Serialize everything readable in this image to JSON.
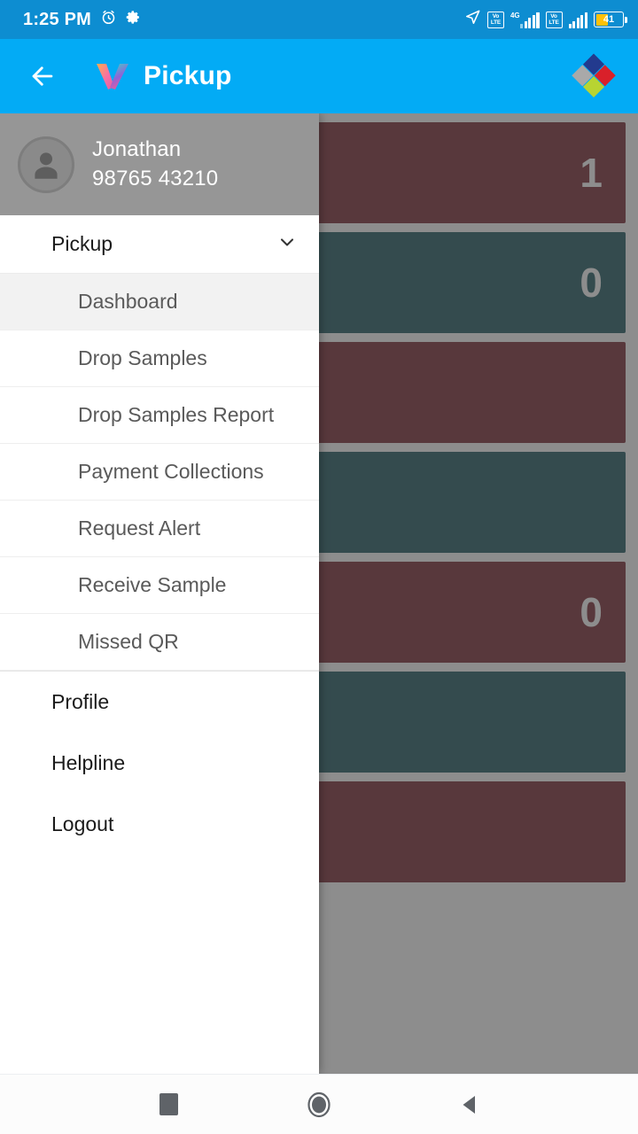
{
  "status_bar": {
    "clock": "1:25 PM",
    "alarm_icon": "alarm-clock-icon",
    "settings_icon": "gear-icon",
    "location_icon": "navigation-arrow-icon",
    "sim1_volte": "VoLTE",
    "sim1_network": "4G",
    "sim2_volte": "VoLTE",
    "battery_percent": "41",
    "battery_level": 41,
    "background_color": "#0d8dd1"
  },
  "app_bar": {
    "back_icon": "back-arrow-icon",
    "logo_icon": "pickup-heart-logo",
    "title": "Pickup",
    "brand_icon": "diamond-brand-logo",
    "background_color": "#03abf5"
  },
  "drawer": {
    "user": {
      "name": "Jonathan",
      "phone": "98765 43210",
      "avatar_icon": "person-avatar-icon"
    },
    "group": {
      "label": "Pickup",
      "expanded": true,
      "chevron_icon": "chevron-down-icon"
    },
    "sub_items": [
      {
        "label": "Dashboard",
        "selected": true
      },
      {
        "label": "Drop Samples",
        "selected": false
      },
      {
        "label": "Drop Samples Report",
        "selected": false
      },
      {
        "label": "Payment Collections",
        "selected": false
      },
      {
        "label": "Request Alert",
        "selected": false
      },
      {
        "label": "Receive Sample",
        "selected": false
      },
      {
        "label": "Missed QR",
        "selected": false
      }
    ],
    "bottom_items": [
      {
        "label": "Profile"
      },
      {
        "label": "Helpline"
      },
      {
        "label": "Logout"
      }
    ],
    "header_background": "#969696",
    "selected_background": "#f2f2f2"
  },
  "content": {
    "cards": [
      {
        "color": "#6d1420",
        "variant": "red",
        "count": "1"
      },
      {
        "color": "#0a4a52",
        "variant": "teal",
        "count": "0"
      },
      {
        "color": "#6d1420",
        "variant": "red",
        "count": ""
      },
      {
        "color": "#0a4a52",
        "variant": "teal",
        "count": ""
      },
      {
        "color": "#6d1420",
        "variant": "red",
        "count": "0"
      },
      {
        "color": "#0a4a52",
        "variant": "teal",
        "count": ""
      },
      {
        "color": "#6d1420",
        "variant": "red",
        "count": ""
      }
    ],
    "scrim_color": "rgba(77,77,77,0.64)"
  },
  "system_nav": {
    "recents_icon": "recents-square-icon",
    "home_icon": "home-circle-icon",
    "back_icon": "back-triangle-icon"
  }
}
